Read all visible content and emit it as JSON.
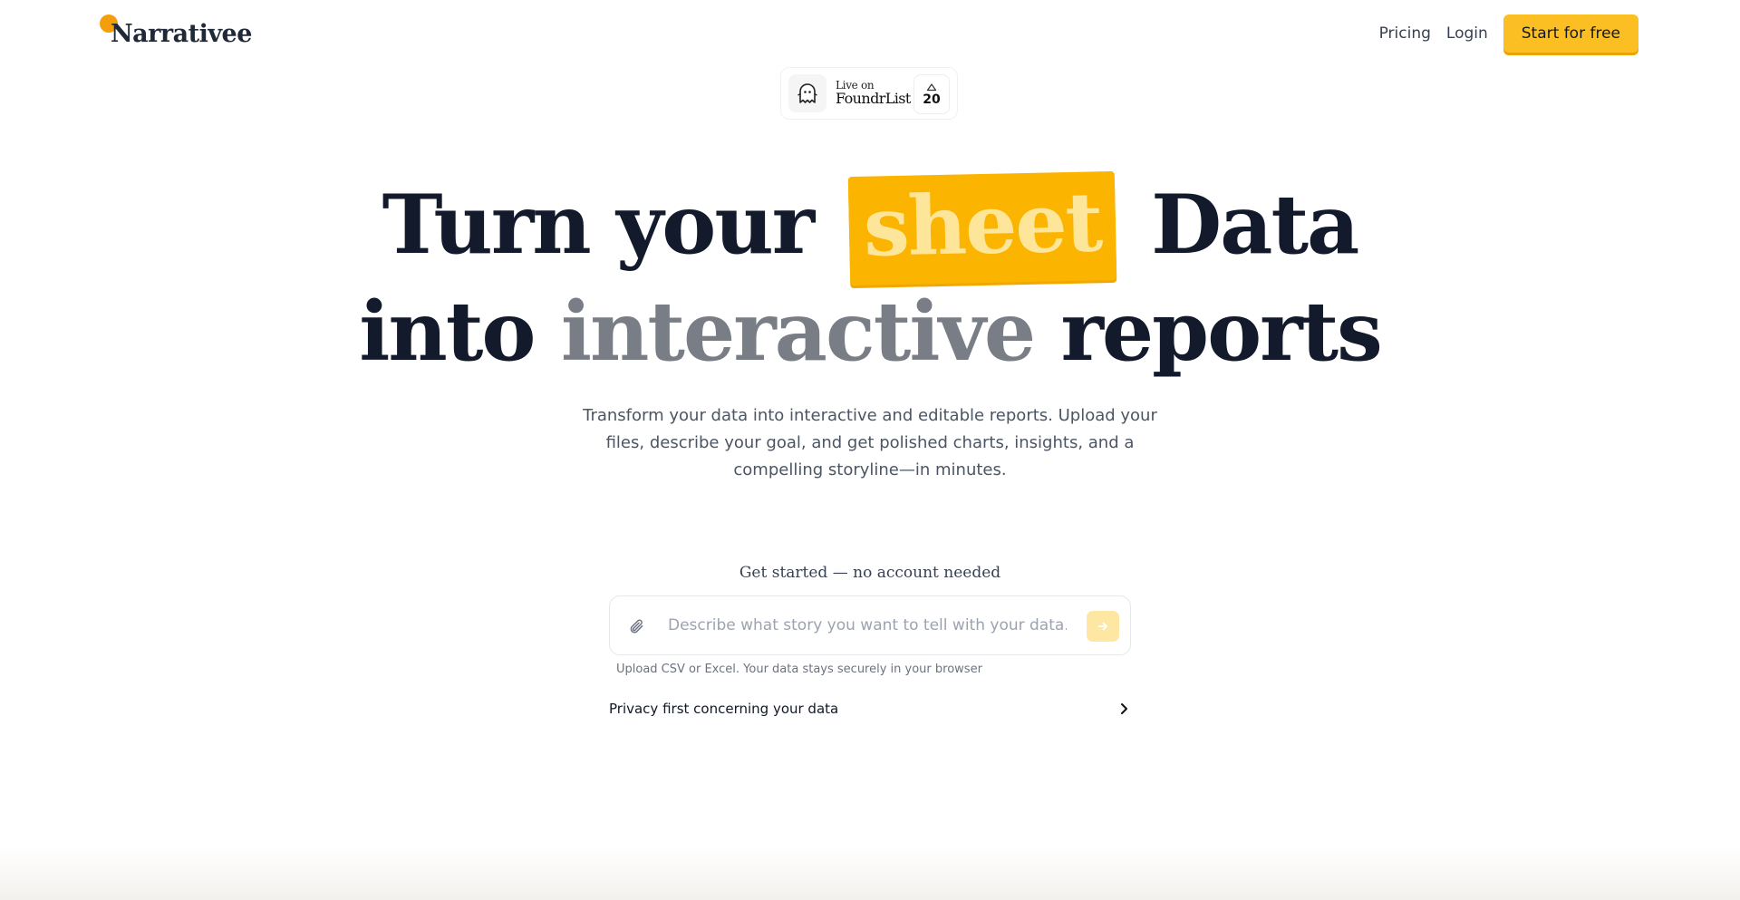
{
  "brand": {
    "name": "Narrativee",
    "dot_color": "#f59e0b"
  },
  "nav": {
    "pricing": "Pricing",
    "login": "Login",
    "cta": "Start for free"
  },
  "badge": {
    "small": "Live on",
    "big": "FoundrList",
    "votes": "20",
    "icon": "ghost-icon"
  },
  "hero": {
    "line1_before": "Turn your",
    "line1_highlight": "sheet",
    "line1_after": "Data",
    "line2_before": "into",
    "line2_muted": "interactive",
    "line2_after": "reports",
    "accent": "#fbb500"
  },
  "subtitle": "Transform your data into interactive and editable reports. Upload your files, describe your goal, and get polished charts, insights, and a compelling storyline—in minutes.",
  "start": {
    "heading": "Get started — no account needed",
    "placeholder": "Describe what story you want to tell with your data...",
    "value": "",
    "helper": "Upload CSV or Excel. Your data stays securely in your browser"
  },
  "privacy": {
    "label": "Privacy first concerning your data"
  }
}
